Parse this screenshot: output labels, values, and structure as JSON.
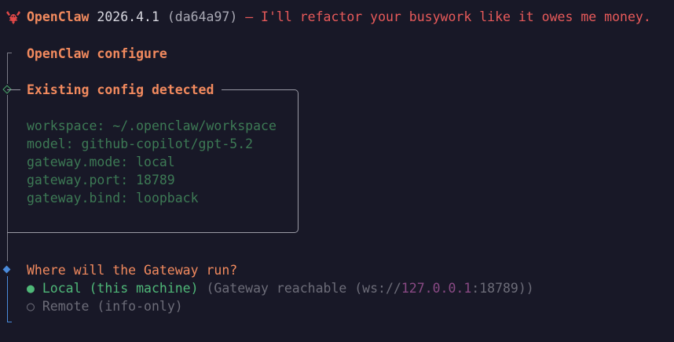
{
  "header": {
    "app_name": "OpenClaw",
    "version": "2026.4.1",
    "commit": "(da64a97)",
    "tagline": "— I'll refactor your busywork like it owes me money."
  },
  "configure_title": "OpenClaw configure",
  "existing_config": {
    "title": "Existing config detected",
    "lines": [
      "workspace: ~/.openclaw/workspace",
      "model: github-copilot/gpt-5.2",
      "gateway.mode: local",
      "gateway.port: 18789",
      "gateway.bind: loopback"
    ]
  },
  "gateway_prompt": {
    "question": "Where will the Gateway run?",
    "options": [
      {
        "marker": "●",
        "label": "Local (this machine)",
        "hint_prefix": "(Gateway reachable (ws://",
        "hint_host": "127.0.0.1",
        "hint_suffix": ":18789))",
        "selected": true
      },
      {
        "marker": "○",
        "label": "Remote (info-only)",
        "selected": false
      }
    ]
  },
  "colors": {
    "background": "#181827",
    "accent_orange": "#f28a5e",
    "tagline_red": "#e85a5a",
    "selected_green": "#4fb878",
    "config_green": "#3d7a55",
    "active_blue": "#4a8bdb"
  },
  "icons": {
    "logo": "lobster-icon",
    "step_done": "diamond-outline-icon",
    "step_active": "diamond-filled-icon"
  }
}
